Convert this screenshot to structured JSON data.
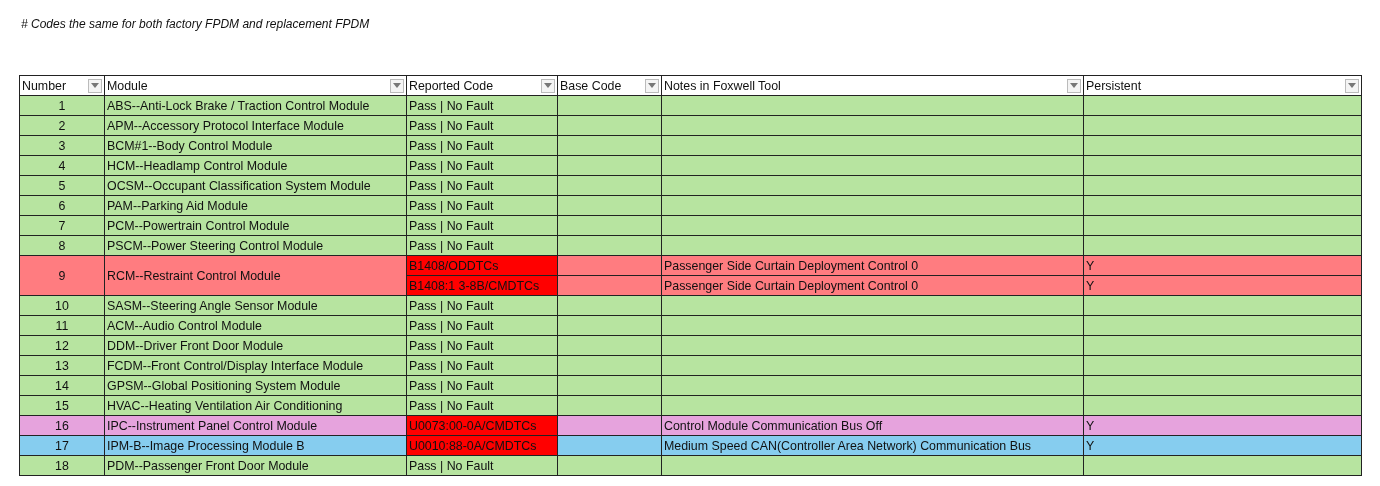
{
  "note": "# Codes the same for both factory FPDM and replacement FPDM",
  "table": {
    "columns": [
      "Number",
      "Module",
      "Reported Code",
      "Base Code",
      "Notes in Foxwell Tool",
      "Persistent"
    ],
    "rows": [
      {
        "number": "1",
        "module": "ABS--Anti-Lock Brake / Traction Control Module",
        "color": "#b7e4a0",
        "codes": [
          {
            "code": "Pass | No Fault",
            "flagged": false
          }
        ]
      },
      {
        "number": "2",
        "module": "APM--Accessory Protocol Interface Module",
        "color": "#b7e4a0",
        "codes": [
          {
            "code": "Pass | No Fault",
            "flagged": false
          }
        ]
      },
      {
        "number": "3",
        "module": "BCM#1--Body Control Module",
        "color": "#b7e4a0",
        "codes": [
          {
            "code": "Pass | No Fault",
            "flagged": false
          }
        ]
      },
      {
        "number": "4",
        "module": "HCM--Headlamp Control Module",
        "color": "#b7e4a0",
        "codes": [
          {
            "code": "Pass | No Fault",
            "flagged": false
          }
        ]
      },
      {
        "number": "5",
        "module": "OCSM--Occupant Classification System Module",
        "color": "#b7e4a0",
        "codes": [
          {
            "code": "Pass | No Fault",
            "flagged": false
          }
        ]
      },
      {
        "number": "6",
        "module": "PAM--Parking Aid Module",
        "color": "#b7e4a0",
        "codes": [
          {
            "code": "Pass | No Fault",
            "flagged": false
          }
        ]
      },
      {
        "number": "7",
        "module": "PCM--Powertrain Control Module",
        "color": "#b7e4a0",
        "codes": [
          {
            "code": "Pass | No Fault",
            "flagged": false
          }
        ]
      },
      {
        "number": "8",
        "module": "PSCM--Power Steering Control Module",
        "color": "#b7e4a0",
        "codes": [
          {
            "code": "Pass | No Fault",
            "flagged": false
          }
        ]
      },
      {
        "number": "9",
        "module": "RCM--Restraint Control Module",
        "color": "#ff7c80",
        "codes": [
          {
            "code": "B1408/ODDTCs",
            "flagged": true,
            "notes": "Passenger Side Curtain Deployment Control 0",
            "persistent": "Y"
          },
          {
            "code": "B1408:1 3-8B/CMDTCs",
            "flagged": true,
            "notes": "Passenger Side Curtain Deployment Control 0",
            "persistent": "Y"
          }
        ]
      },
      {
        "number": "10",
        "module": "SASM--Steering Angle Sensor Module",
        "color": "#b7e4a0",
        "codes": [
          {
            "code": "Pass | No Fault",
            "flagged": false
          }
        ]
      },
      {
        "number": "11",
        "module": "ACM--Audio Control Module",
        "color": "#b7e4a0",
        "codes": [
          {
            "code": "Pass | No Fault",
            "flagged": false
          }
        ]
      },
      {
        "number": "12",
        "module": "DDM--Driver Front Door Module",
        "color": "#b7e4a0",
        "codes": [
          {
            "code": "Pass | No Fault",
            "flagged": false
          }
        ]
      },
      {
        "number": "13",
        "module": "FCDM--Front Control/Display Interface Module",
        "color": "#b7e4a0",
        "codes": [
          {
            "code": "Pass | No Fault",
            "flagged": false
          }
        ]
      },
      {
        "number": "14",
        "module": "GPSM--Global Positioning System Module",
        "color": "#b7e4a0",
        "codes": [
          {
            "code": "Pass | No Fault",
            "flagged": false
          }
        ]
      },
      {
        "number": "15",
        "module": "HVAC--Heating Ventilation Air Conditioning",
        "color": "#b7e4a0",
        "codes": [
          {
            "code": "Pass | No Fault",
            "flagged": false
          }
        ]
      },
      {
        "number": "16",
        "module": "IPC--Instrument Panel Control Module",
        "color": "#e6a3dd",
        "codes": [
          {
            "code": "U0073:00-0A/CMDTCs",
            "flagged": true,
            "notes": "Control Module Communication Bus Off",
            "persistent": "Y"
          }
        ]
      },
      {
        "number": "17",
        "module": "IPM-B--Image Processing Module B",
        "color": "#86cdef",
        "codes": [
          {
            "code": "U0010:88-0A/CMDTCs",
            "flagged": true,
            "notes": "Medium Speed CAN(Controller Area Network) Communication Bus",
            "persistent": "Y"
          }
        ]
      },
      {
        "number": "18",
        "module": "PDM--Passenger Front Door Module",
        "color": "#b7e4a0",
        "codes": [
          {
            "code": "Pass | No Fault",
            "flagged": false
          }
        ]
      }
    ]
  }
}
